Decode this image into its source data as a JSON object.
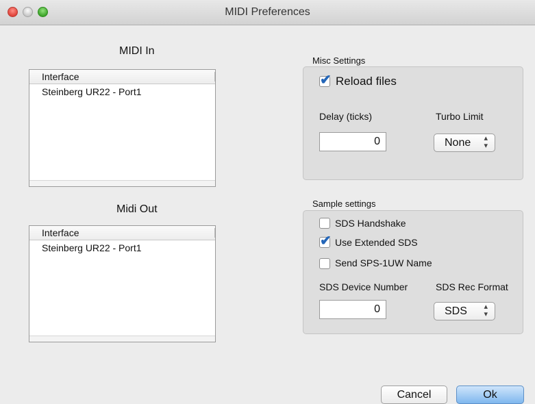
{
  "window": {
    "title": "MIDI Preferences"
  },
  "midi_in": {
    "title": "MIDI In",
    "column_header": "Interface",
    "rows": [
      "Steinberg UR22 - Port1"
    ]
  },
  "midi_out": {
    "title": "Midi Out",
    "column_header": "Interface",
    "rows": [
      "Steinberg UR22 - Port1"
    ]
  },
  "misc_settings": {
    "label": "Misc Settings",
    "reload_files": {
      "label": "Reload files",
      "checked": true
    },
    "delay": {
      "label": "Delay (ticks)",
      "value": "0"
    },
    "turbo_limit": {
      "label": "Turbo Limit",
      "value": "None"
    }
  },
  "sample_settings": {
    "label": "Sample settings",
    "sds_handshake": {
      "label": "SDS Handshake",
      "checked": false
    },
    "use_extended_sds": {
      "label": "Use Extended SDS",
      "checked": true
    },
    "send_sps_name": {
      "label": "Send SPS-1UW Name",
      "checked": false
    },
    "device_number": {
      "label": "SDS Device Number",
      "value": "0"
    },
    "rec_format": {
      "label": "SDS Rec Format",
      "value": "SDS"
    }
  },
  "buttons": {
    "cancel": "Cancel",
    "ok": "Ok"
  }
}
